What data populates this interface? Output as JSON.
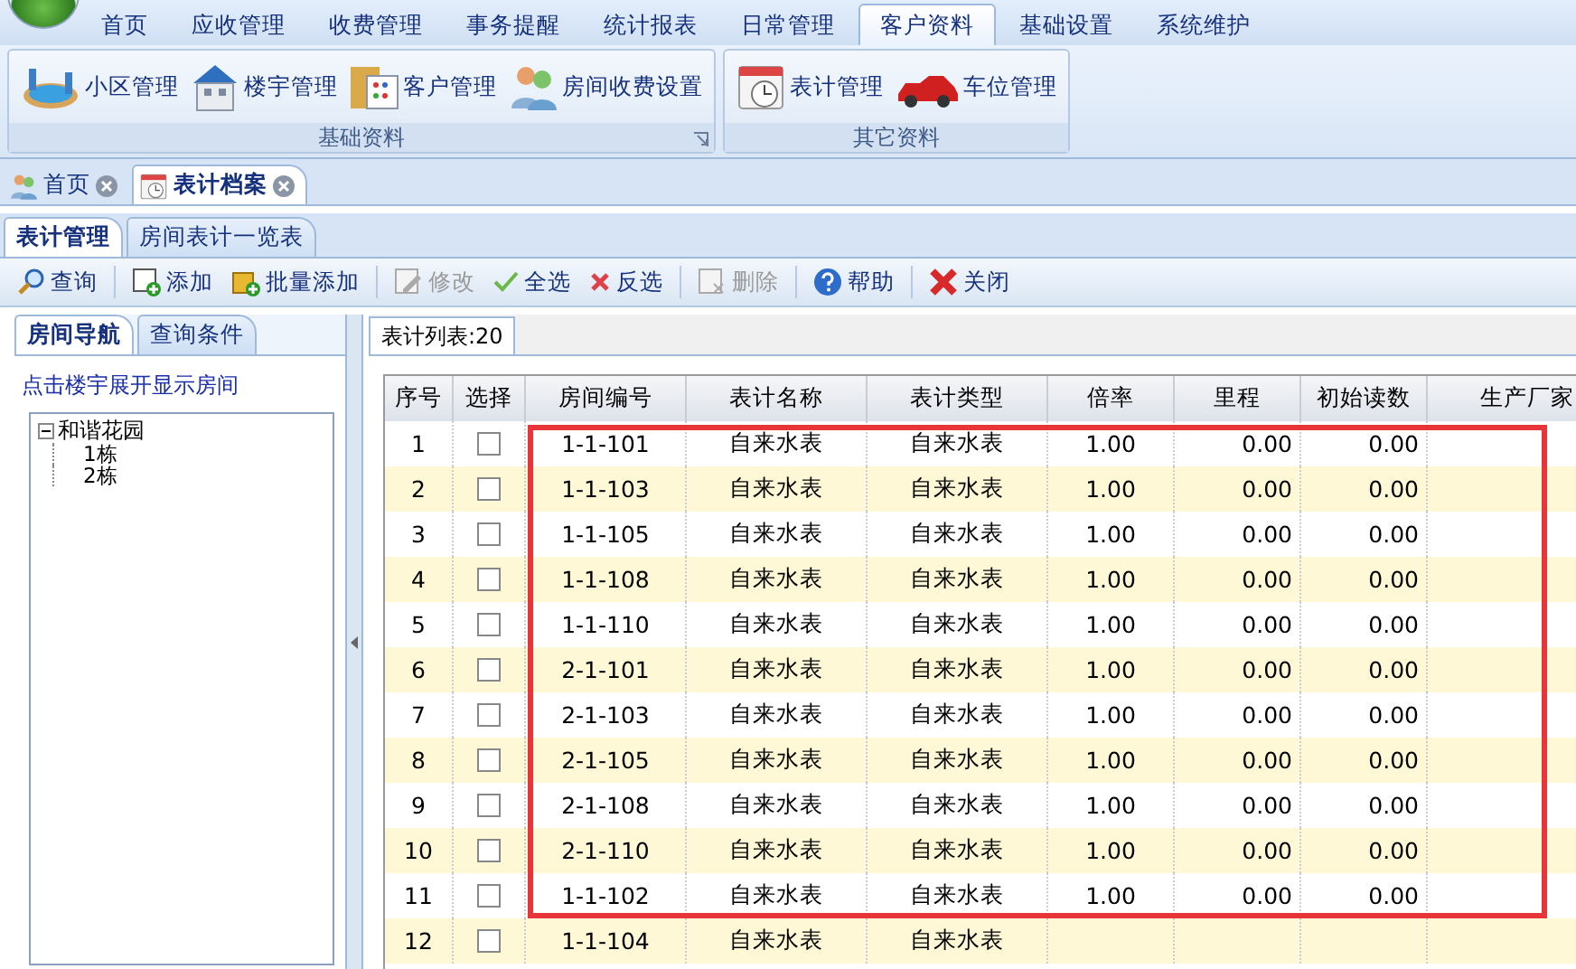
{
  "menu_tabs": [
    {
      "label": "首页",
      "selected": false
    },
    {
      "label": "应收管理",
      "selected": false
    },
    {
      "label": "收费管理",
      "selected": false
    },
    {
      "label": "事务提醒",
      "selected": false
    },
    {
      "label": "统计报表",
      "selected": false
    },
    {
      "label": "日常管理",
      "selected": false
    },
    {
      "label": "客户资料",
      "selected": true
    },
    {
      "label": "基础设置",
      "selected": false
    },
    {
      "label": "系统维护",
      "selected": false
    }
  ],
  "ribbon_groups": [
    {
      "title": "基础资料",
      "launcher": true,
      "items": [
        {
          "label": "小区管理",
          "kind": "pool"
        },
        {
          "label": "楼宇管理",
          "kind": "building"
        },
        {
          "label": "客户管理",
          "kind": "folder"
        },
        {
          "label": "房间收费设置",
          "kind": "people"
        }
      ]
    },
    {
      "title": "其它资料",
      "launcher": false,
      "items": [
        {
          "label": "表计管理",
          "kind": "calendar"
        },
        {
          "label": "车位管理",
          "kind": "car"
        }
      ]
    }
  ],
  "doc_tabs": [
    {
      "label": "首页",
      "kind": "people",
      "selected": false
    },
    {
      "label": "表计档案",
      "kind": "calendar",
      "selected": true
    }
  ],
  "sub_tabs": [
    {
      "label": "表计管理",
      "selected": true
    },
    {
      "label": "房间表计一览表",
      "selected": false
    }
  ],
  "toolbar": [
    {
      "label": "查询",
      "kind": "search",
      "disabled": false
    },
    {
      "label": "添加",
      "kind": "add",
      "disabled": false
    },
    {
      "label": "批量添加",
      "kind": "batch",
      "disabled": false
    },
    {
      "label": "修改",
      "kind": "edit",
      "disabled": true
    },
    {
      "label": "全选",
      "kind": "check",
      "disabled": false
    },
    {
      "label": "反选",
      "kind": "cross",
      "disabled": false
    },
    {
      "label": "删除",
      "kind": "delete",
      "disabled": true
    },
    {
      "label": "帮助",
      "kind": "help",
      "disabled": false
    },
    {
      "label": "关闭",
      "kind": "close",
      "disabled": false
    }
  ],
  "left_panel": {
    "tabs": [
      {
        "label": "房间导航",
        "selected": true
      },
      {
        "label": "查询条件",
        "selected": false
      }
    ],
    "hint": "点击楼宇展开显示房间",
    "tree": [
      {
        "label": "和谐花园",
        "expanded": true,
        "children": [
          {
            "label": "1栋"
          },
          {
            "label": "2栋"
          }
        ]
      }
    ]
  },
  "list_tab": {
    "label": "表计列表:20"
  },
  "table": {
    "columns": [
      "序号",
      "选择",
      "房间编号",
      "表计名称",
      "表计类型",
      "倍率",
      "里程",
      "初始读数",
      "生产厂家"
    ],
    "rows": [
      {
        "no": "1",
        "checked": false,
        "room": "1-1-101",
        "name": "自来水表",
        "type": "自来水表",
        "rate": "1.00",
        "mileage": "0.00",
        "initial": "0.00"
      },
      {
        "no": "2",
        "checked": false,
        "room": "1-1-103",
        "name": "自来水表",
        "type": "自来水表",
        "rate": "1.00",
        "mileage": "0.00",
        "initial": "0.00"
      },
      {
        "no": "3",
        "checked": false,
        "room": "1-1-105",
        "name": "自来水表",
        "type": "自来水表",
        "rate": "1.00",
        "mileage": "0.00",
        "initial": "0.00"
      },
      {
        "no": "4",
        "checked": false,
        "room": "1-1-108",
        "name": "自来水表",
        "type": "自来水表",
        "rate": "1.00",
        "mileage": "0.00",
        "initial": "0.00"
      },
      {
        "no": "5",
        "checked": false,
        "room": "1-1-110",
        "name": "自来水表",
        "type": "自来水表",
        "rate": "1.00",
        "mileage": "0.00",
        "initial": "0.00"
      },
      {
        "no": "6",
        "checked": false,
        "room": "2-1-101",
        "name": "自来水表",
        "type": "自来水表",
        "rate": "1.00",
        "mileage": "0.00",
        "initial": "0.00"
      },
      {
        "no": "7",
        "checked": false,
        "room": "2-1-103",
        "name": "自来水表",
        "type": "自来水表",
        "rate": "1.00",
        "mileage": "0.00",
        "initial": "0.00"
      },
      {
        "no": "8",
        "checked": false,
        "room": "2-1-105",
        "name": "自来水表",
        "type": "自来水表",
        "rate": "1.00",
        "mileage": "0.00",
        "initial": "0.00"
      },
      {
        "no": "9",
        "checked": false,
        "room": "2-1-108",
        "name": "自来水表",
        "type": "自来水表",
        "rate": "1.00",
        "mileage": "0.00",
        "initial": "0.00"
      },
      {
        "no": "10",
        "checked": false,
        "room": "2-1-110",
        "name": "自来水表",
        "type": "自来水表",
        "rate": "1.00",
        "mileage": "0.00",
        "initial": "0.00"
      },
      {
        "no": "11",
        "checked": false,
        "room": "1-1-102",
        "name": "自来水表",
        "type": "自来水表",
        "rate": "1.00",
        "mileage": "0.00",
        "initial": "0.00"
      },
      {
        "no": "12",
        "checked": false,
        "room": "1-1-104",
        "name": "自来水表",
        "type": "自来水表"
      }
    ]
  },
  "annotation": {
    "kind": "rectangle",
    "color": "#e8353a"
  }
}
